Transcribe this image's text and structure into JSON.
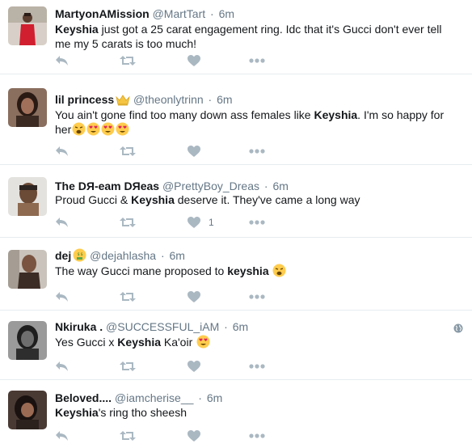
{
  "tweets": [
    {
      "name": "MartyonAMission",
      "handle": "@MartTart",
      "time": "6m",
      "kw": "Keyshia",
      "text_a": " just got a 25 carat engagement ring. Idc that it's Gucci don't ever tell me my 5 carats is too much!"
    },
    {
      "name": "lil princess",
      "handle": "@theonlytrinn",
      "time": "6m",
      "text_a": "You ain't gone find too many down ass females like ",
      "kw": "Keyshia",
      "text_b": ". I'm so happy for her",
      "emojis": [
        "weary-face",
        "heart-eyes-face",
        "heart-eyes-face",
        "heart-eyes-face"
      ]
    },
    {
      "name": "The DЯ-eam DЯeas",
      "handle": "@PrettyBoy_Dreas",
      "time": "6m",
      "text_a": "Proud Gucci & ",
      "kw": "Keyshia",
      "text_b": " deserve it. They've came a long way",
      "like_count": "1"
    },
    {
      "name": "dej",
      "handle": "@dejahlasha",
      "time": "6m",
      "text_a": "The way Gucci mane proposed to ",
      "kw": "keyshia",
      "emojis": [
        "weary-face"
      ]
    },
    {
      "name": "Nkiruka .",
      "handle": "@SUCCESSFUL_iAM",
      "time": "6m",
      "text_a": "Yes Gucci x ",
      "kw": "Keyshia",
      "text_b": " Ka'oir ",
      "emojis": [
        "heart-eyes-face"
      ]
    },
    {
      "name": "Beloved....",
      "handle": "@iamcherise__",
      "time": "6m",
      "kw": "Keyshia",
      "text_a": "'s ring tho sheesh"
    }
  ],
  "separator": "·",
  "colors": {
    "action_gray": "#aab8c2",
    "meta_gray": "#657786",
    "divider": "#e6ecf0"
  }
}
